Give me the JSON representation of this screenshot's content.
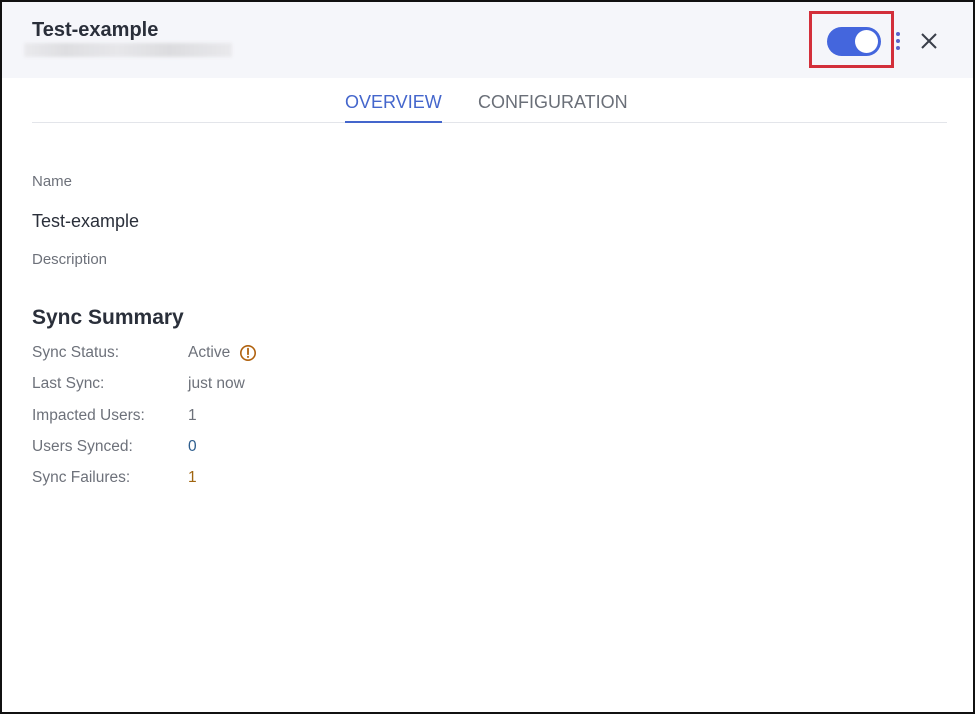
{
  "header": {
    "title": "Test-example",
    "toggle_state": "on",
    "accent_color": "#4466dd",
    "highlight_color": "#d32f3a",
    "icons": [
      "more-vertical-icon",
      "close-icon"
    ]
  },
  "tabs": [
    {
      "label": "OVERVIEW",
      "active": true
    },
    {
      "label": "CONFIGURATION",
      "active": false
    }
  ],
  "details": {
    "name_label": "Name",
    "name_value": "Test-example",
    "description_label": "Description"
  },
  "sync_summary": {
    "title": "Sync Summary",
    "rows": [
      {
        "label": "Sync Status:",
        "value": "Active",
        "icon": "warning-circle-icon"
      },
      {
        "label": "Last Sync:",
        "value": "just now"
      },
      {
        "label": "Impacted Users:",
        "value": "1"
      },
      {
        "label": "Users Synced:",
        "value": "0"
      },
      {
        "label": "Sync Failures:",
        "value": "1"
      }
    ]
  }
}
